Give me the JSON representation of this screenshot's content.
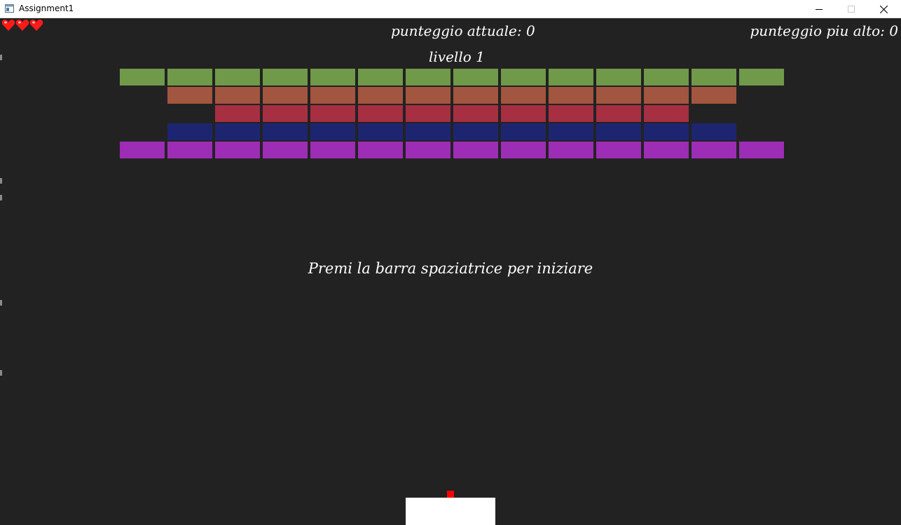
{
  "window": {
    "title": "Assignment1",
    "controls": {
      "minimize_icon": "minimize-icon",
      "maximize_icon": "maximize-icon",
      "close_icon": "close-icon"
    }
  },
  "hud": {
    "score_current": "punteggio attuale: 0",
    "score_best": "punteggio piu alto: 0",
    "level": "livello 1",
    "lives": 3,
    "life_icon": "heart-icon",
    "life_color": "#ff1a1a"
  },
  "message": "Premi la barra spaziatrice per iniziare",
  "colors": {
    "background": "#222222",
    "paddle": "#ffffff",
    "ball": "#ff0000"
  },
  "bricks": {
    "rows": [
      {
        "color": "#70994a",
        "columns": [
          0,
          1,
          2,
          3,
          4,
          5,
          6,
          7,
          8,
          9,
          10,
          11,
          12,
          13
        ]
      },
      {
        "color": "#a2553f",
        "columns": [
          1,
          2,
          3,
          4,
          5,
          6,
          7,
          8,
          9,
          10,
          11,
          12
        ]
      },
      {
        "color": "#a62f42",
        "columns": [
          2,
          3,
          4,
          5,
          6,
          7,
          8,
          9,
          10,
          11
        ]
      },
      {
        "color": "#1e2570",
        "columns": [
          1,
          2,
          3,
          4,
          5,
          6,
          7,
          8,
          9,
          10,
          11,
          12
        ]
      },
      {
        "color": "#9d2db5",
        "columns": [
          0,
          1,
          2,
          3,
          4,
          5,
          6,
          7,
          8,
          9,
          10,
          11,
          12,
          13
        ]
      }
    ]
  }
}
